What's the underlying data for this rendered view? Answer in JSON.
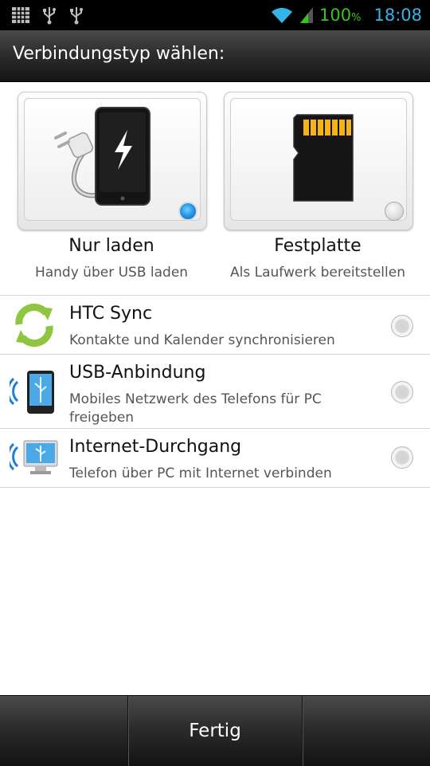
{
  "status_bar": {
    "icons": [
      "sd-card-icon",
      "usb-icon",
      "usb-debug-icon",
      "wifi-icon",
      "signal-icon"
    ],
    "battery": "100",
    "battery_unit": "%",
    "time": "18:08"
  },
  "title": "Verbindungstyp wählen:",
  "tiles": [
    {
      "label": "Nur laden",
      "sub": "Handy über USB laden",
      "icon": "phone-charging-icon",
      "selected": true
    },
    {
      "label": "Festplatte",
      "sub": "Als Laufwerk bereitstellen",
      "icon": "sd-card-icon",
      "selected": false
    }
  ],
  "list": [
    {
      "title": "HTC Sync",
      "desc": "Kontakte und Kalender synchronisieren",
      "icon": "sync-icon"
    },
    {
      "title": "USB-Anbindung",
      "desc": "Mobiles Netzwerk des Telefons für PC freigeben",
      "icon": "usb-tethering-icon"
    },
    {
      "title": "Internet-Durchgang",
      "desc": "Telefon über PC mit Internet verbinden",
      "icon": "internet-pass-through-icon"
    }
  ],
  "bottom": {
    "done_label": "Fertig"
  },
  "colors": {
    "battery": "#35c51e",
    "time": "#35b4e8",
    "radio_selected": "#1e8fe0"
  }
}
